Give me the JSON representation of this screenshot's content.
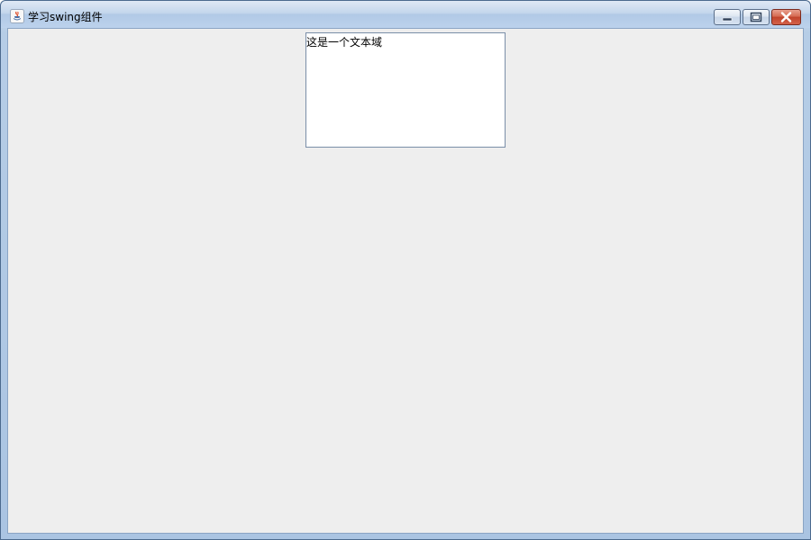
{
  "window": {
    "title": "学习swing组件",
    "icon": "java-cup-icon"
  },
  "caption_buttons": {
    "minimize_icon": "minimize-icon",
    "maximize_icon": "maximize-icon",
    "close_icon": "close-icon"
  },
  "content": {
    "text_area": {
      "value": "这是一个文本域"
    }
  },
  "colors": {
    "client_background": "#eeeeee",
    "text_area_background": "#ffffff",
    "close_button": "#c0432b"
  }
}
